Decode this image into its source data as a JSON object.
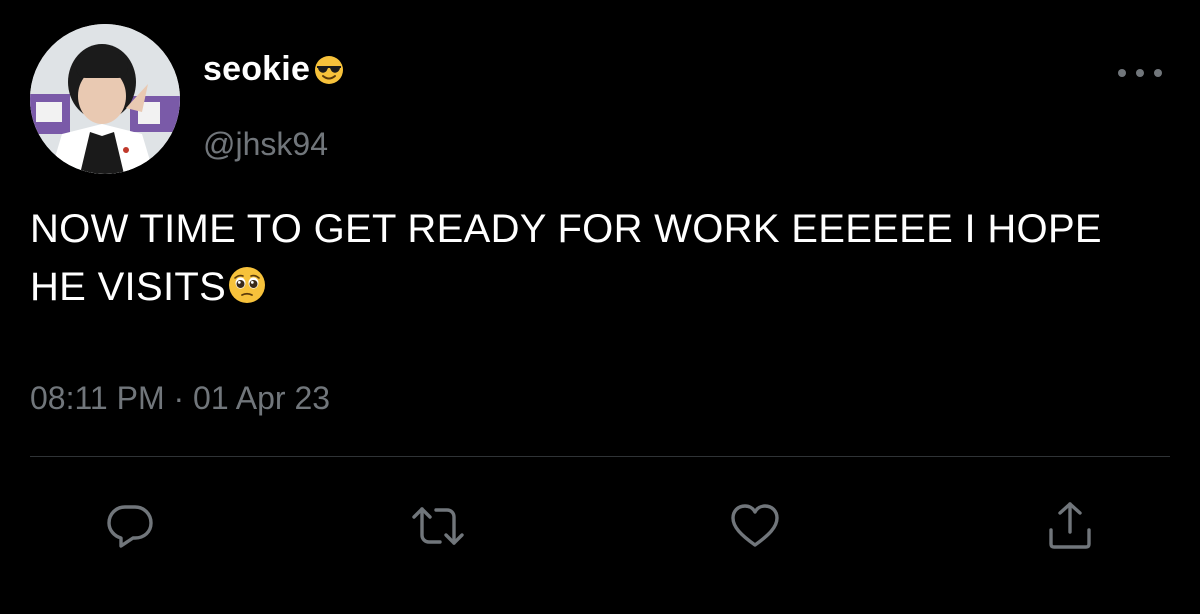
{
  "tweet": {
    "display_name": "seokie",
    "display_name_emoji": "smiling-face-with-sunglasses-emoji",
    "handle": "@jhsk94",
    "text": "NOW TIME TO GET READY FOR WORK EEEEEE I HOPE HE VISITS",
    "text_emoji": "pleading-face-emoji",
    "time": "08:11 PM",
    "separator": "·",
    "date": "01 Apr 23"
  },
  "icons": {
    "more": "more-horizontal-icon",
    "reply": "reply-icon",
    "retweet": "retweet-icon",
    "like": "heart-icon",
    "share": "share-icon"
  },
  "colors": {
    "background": "#000000",
    "text_primary": "#ffffff",
    "text_secondary": "#71767b",
    "divider": "#2f3336"
  }
}
